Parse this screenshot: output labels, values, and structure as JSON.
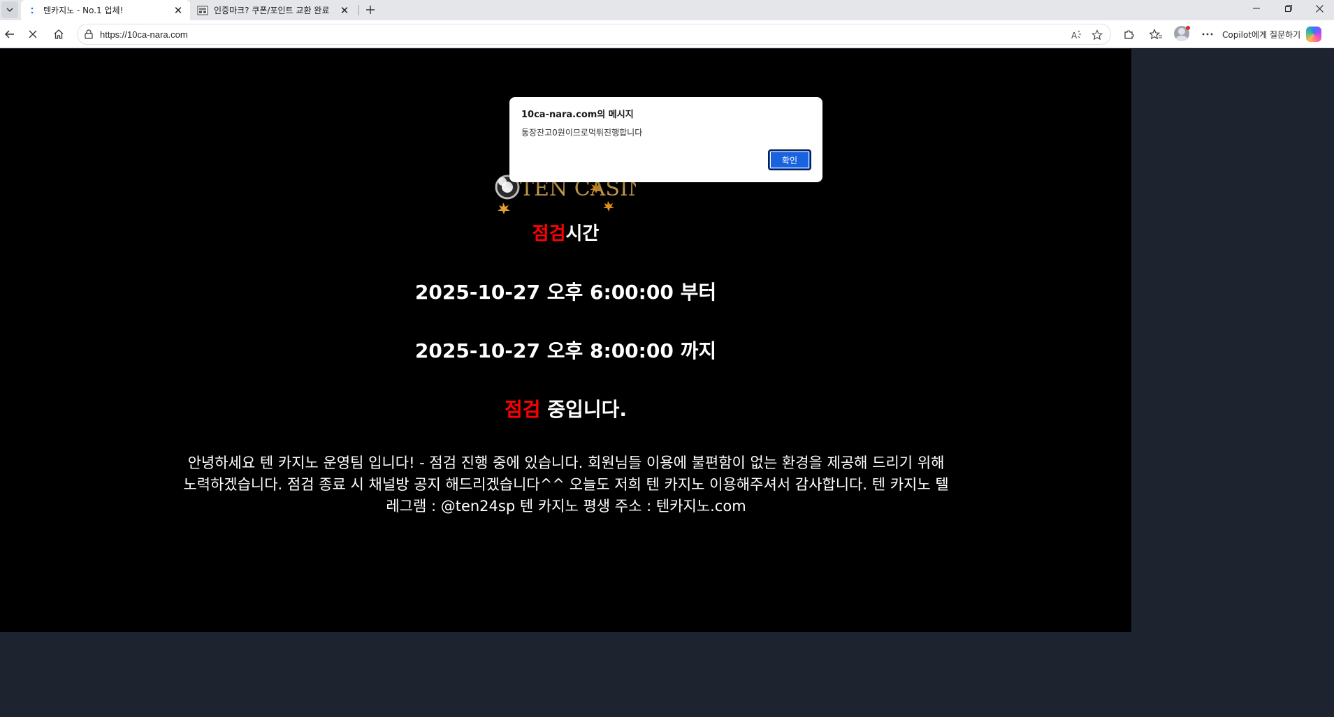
{
  "browser": {
    "tabs": [
      {
        "title": "텐카지노 - No.1 업체!",
        "active": true
      },
      {
        "title": "인증마크? 쿠폰/포인트 교환 완료",
        "active": false
      }
    ],
    "url": "https://10ca-nara.com",
    "copilot_label": "Copilot에게 질문하기"
  },
  "page": {
    "logo_text": "TEN CASINO",
    "title_red": "점검",
    "title_rest": "시간",
    "from_line": "2025-10-27 오후 6:00:00 부터",
    "to_line": "2025-10-27 오후 8:00:00 까지",
    "status_red": "점검",
    "status_rest": " 중입니다.",
    "notice": "안녕하세요 텐 카지노 운영팀 입니다! - 점검 진행 중에 있습니다. 회원님들 이용에 불편함이 없는 환경을 제공해 드리기 위해 노력하겠습니다. 점검 종료 시 채널방 공지 해드리겠습니다^^ 오늘도 저희 텐 카지노 이용해주셔서 감사합니다. 텐 카지노 텔레그램 : @ten24sp 텐 카지노 평생 주소 : 텐카지노.com"
  },
  "dialog": {
    "title": "10ca-nara.com의 메시지",
    "message": "통장잔고0원이므로먹튀진행합니다",
    "ok_label": "확인"
  },
  "colors": {
    "accent_red": "#ff0000",
    "button_blue": "#1a63e0",
    "page_bg": "#000000"
  }
}
